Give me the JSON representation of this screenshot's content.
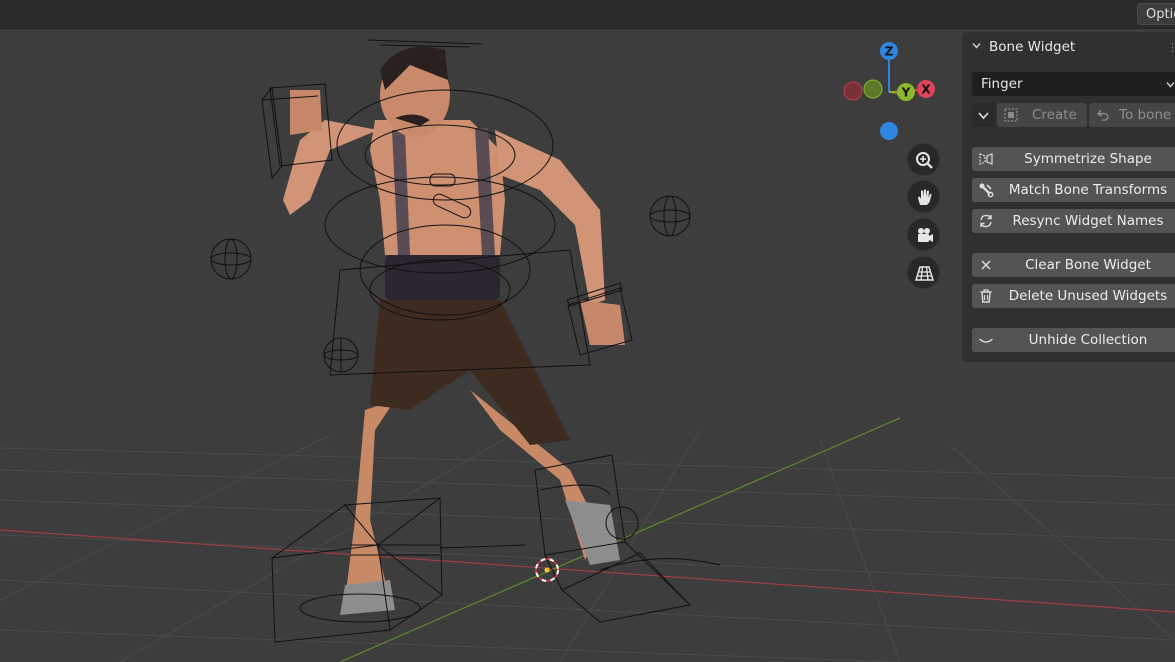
{
  "top_bar": {
    "options_label": "Options"
  },
  "gizmo": {
    "z": "Z",
    "y": "Y",
    "x": "X"
  },
  "panel": {
    "title": "Bone Widget",
    "widget_select": "Finger",
    "create_label": "Create",
    "to_bone_label": "To bone",
    "buttons": {
      "symmetrize": "Symmetrize Shape",
      "match": "Match Bone Transforms",
      "resync": "Resync Widget Names",
      "clear": "Clear Bone Widget",
      "delete": "Delete Unused Widgets",
      "unhide": "Unhide Collection"
    }
  },
  "navigation": {
    "icons": [
      "zoom-icon",
      "hand-pan-icon",
      "camera-icon",
      "grid-perspective-icon"
    ]
  },
  "colors": {
    "x_axis": "#e0445a",
    "y_axis": "#8bb82c",
    "z_axis": "#2f86e0",
    "panel_bg": "#303030",
    "button_bg": "#545454"
  }
}
